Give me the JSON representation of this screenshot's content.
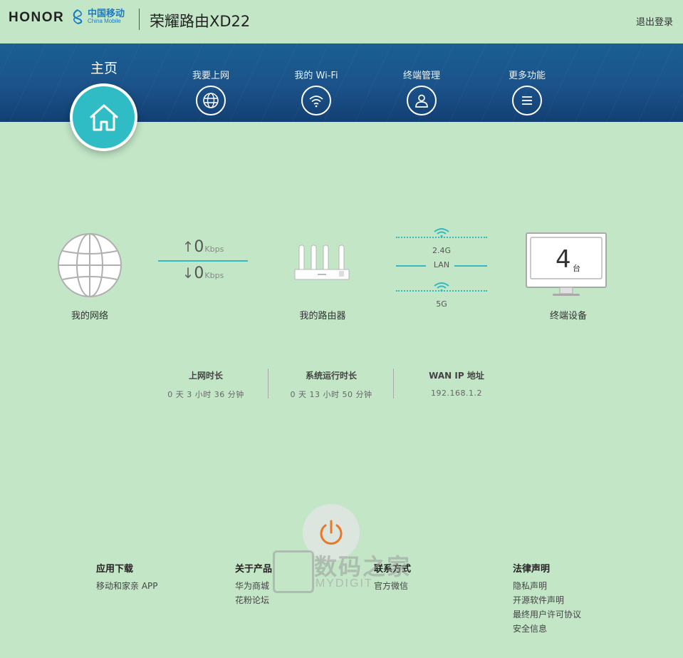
{
  "header": {
    "brand": "HONOR",
    "operator_cn": "中国移动",
    "operator_en": "China Mobile",
    "product_title": "荣耀路由XD22",
    "logout": "退出登录"
  },
  "nav": {
    "home": "主页",
    "items": [
      {
        "label": "我要上网",
        "icon": "globe-icon"
      },
      {
        "label": "我的 Wi-Fi",
        "icon": "wifi-icon"
      },
      {
        "label": "终端管理",
        "icon": "user-icon"
      },
      {
        "label": "更多功能",
        "icon": "menu-icon"
      }
    ]
  },
  "topology": {
    "network_label": "我的网络",
    "upload": "0",
    "download": "0",
    "speed_unit": "Kbps",
    "router_label": "我的路由器",
    "band_24": "2.4G",
    "lan": "LAN",
    "band_5": "5G",
    "device_count": "4",
    "device_unit": "台",
    "devices_label": "终端设备"
  },
  "stats": [
    {
      "title": "上网时长",
      "value": "0 天 3 小时 36 分钟"
    },
    {
      "title": "系统运行时长",
      "value": "0 天 13 小时 50 分钟"
    },
    {
      "title": "WAN IP 地址",
      "value": "192.168.1.2"
    }
  ],
  "footer": {
    "cols": [
      {
        "head": "应用下载",
        "links": [
          "移动和家亲 APP"
        ]
      },
      {
        "head": "关于产品",
        "links": [
          "华为商城",
          "花粉论坛"
        ]
      },
      {
        "head": "联系方式",
        "links": [
          "官方微信"
        ]
      },
      {
        "head": "法律声明",
        "links": [
          "隐私声明",
          "开源软件声明",
          "最终用户许可协议",
          "安全信息"
        ]
      }
    ]
  },
  "watermark": {
    "cn": "数码之家",
    "en": "MYDIGIT"
  },
  "colors": {
    "background": "#c3e6c7",
    "nav": "#1b5289",
    "accent": "#36b8c0",
    "power": "#e8782a"
  }
}
